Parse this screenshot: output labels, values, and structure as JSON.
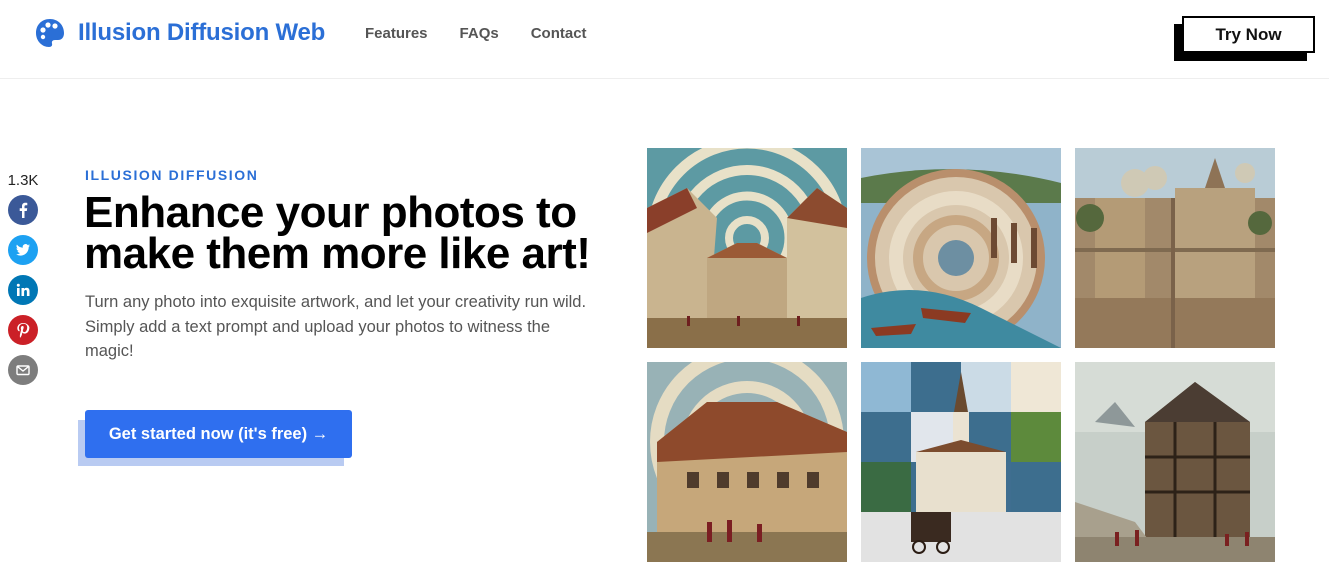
{
  "header": {
    "brand": "Illusion Diffusion Web",
    "logo_icon": "palette-icon",
    "nav": [
      {
        "label": "Features"
      },
      {
        "label": "FAQs"
      },
      {
        "label": "Contact"
      }
    ],
    "try_now_label": "Try Now"
  },
  "share": {
    "count": "1.3K",
    "buttons": [
      {
        "icon": "facebook-icon",
        "color": "#3b5998"
      },
      {
        "icon": "twitter-icon",
        "color": "#1da1f2"
      },
      {
        "icon": "linkedin-icon",
        "color": "#0077b5"
      },
      {
        "icon": "pinterest-icon",
        "color": "#cb2027"
      },
      {
        "icon": "email-icon",
        "color": "#7d7d7d"
      }
    ]
  },
  "hero": {
    "eyebrow": "ILLUSION DIFFUSION",
    "title": "Enhance your photos to make them more like art!",
    "description": "Turn any photo into exquisite artwork, and let your creativity run wild. Simply add a text prompt and upload your photos to witness the magic!",
    "cta_label": "Get started now (it's free) →"
  },
  "gallery": {
    "images": [
      {
        "subject": "spiral village street"
      },
      {
        "subject": "spiral canal with boats"
      },
      {
        "subject": "hidden cube castle"
      },
      {
        "subject": "spiral timber houses with crowd"
      },
      {
        "subject": "checkerboard church square"
      },
      {
        "subject": "timber house with crowd"
      }
    ]
  },
  "colors": {
    "brand_blue": "#2b6fd6",
    "cta_blue": "#2f6fef",
    "cta_shadow": "#b9cbf2"
  }
}
